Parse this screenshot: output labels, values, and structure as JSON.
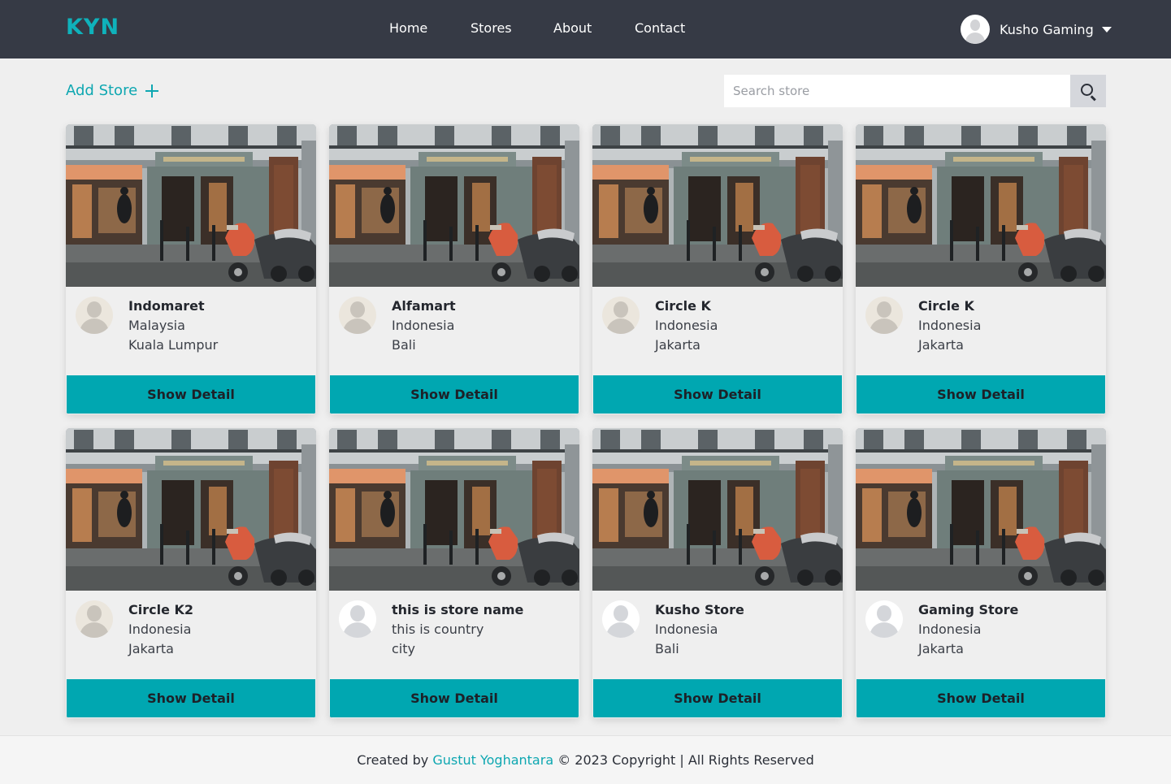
{
  "navbar": {
    "logo": "KYN",
    "links": [
      "Home",
      "Stores",
      "About",
      "Contact"
    ],
    "user_name": "Kusho Gaming"
  },
  "toolbar": {
    "add_store_label": "Add Store",
    "search_placeholder": "Search store"
  },
  "stores": [
    {
      "name": "Indomaret",
      "country": "Malaysia",
      "city": "Kuala Lumpur",
      "avatar": "beige"
    },
    {
      "name": "Alfamart",
      "country": "Indonesia",
      "city": "Bali",
      "avatar": "beige"
    },
    {
      "name": "Circle K",
      "country": "Indonesia",
      "city": "Jakarta",
      "avatar": "beige"
    },
    {
      "name": "Circle K",
      "country": "Indonesia",
      "city": "Jakarta",
      "avatar": "beige"
    },
    {
      "name": "Circle K2",
      "country": "Indonesia",
      "city": "Jakarta",
      "avatar": "beige"
    },
    {
      "name": "this is store name",
      "country": "this is country",
      "city": "city",
      "avatar": "white"
    },
    {
      "name": "Kusho Store",
      "country": "Indonesia",
      "city": "Bali",
      "avatar": "white"
    },
    {
      "name": "Gaming Store",
      "country": "Indonesia",
      "city": "Jakarta",
      "avatar": "white"
    }
  ],
  "card_button_label": "Show Detail",
  "footer": {
    "prefix": "Created by",
    "author": "Gustut Yoghantara",
    "suffix": "© 2023 Copyright | All Rights Reserved"
  },
  "colors": {
    "navbar_bg": "#363a45",
    "accent": "#00a7b1",
    "page_bg": "#efefef"
  }
}
